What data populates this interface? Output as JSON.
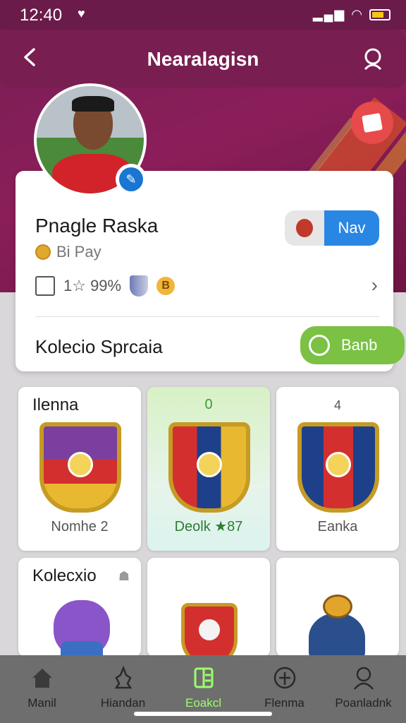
{
  "status_bar": {
    "time": "12:40",
    "signal_text": "ଏ͜ ıll"
  },
  "header": {
    "title": "Nearalagisn"
  },
  "profile": {
    "name": "Pnagle Raska",
    "subtitle": "Bi Pay",
    "stats": "1☆ 99%",
    "nav_label": "Nav",
    "collection_label": "Kolecio Sprcaia",
    "bank_label": "Banb"
  },
  "grid": [
    {
      "header": "Ilenna",
      "caption": "Nomhe 2"
    },
    {
      "header": "0",
      "caption": "Deolk ★87"
    },
    {
      "header": "4",
      "caption": "Eanka"
    },
    {
      "header": "Kolecxio",
      "caption": ""
    },
    {
      "header": "",
      "caption": ""
    },
    {
      "header": "",
      "caption": ""
    }
  ],
  "bottom_nav": [
    {
      "label": "Manil",
      "icon": "home-icon"
    },
    {
      "label": "Hiandan",
      "icon": "trophy-icon"
    },
    {
      "label": "Eoakcl",
      "icon": "collection-icon",
      "active": true
    },
    {
      "label": "Flenma",
      "icon": "ball-icon"
    },
    {
      "label": "Poanladnk",
      "icon": "profile-icon"
    }
  ],
  "colors": {
    "primary": "#7a1f55",
    "accent_blue": "#2a86e3",
    "accent_green": "#7ac144",
    "active_tab": "#9cff6a"
  }
}
